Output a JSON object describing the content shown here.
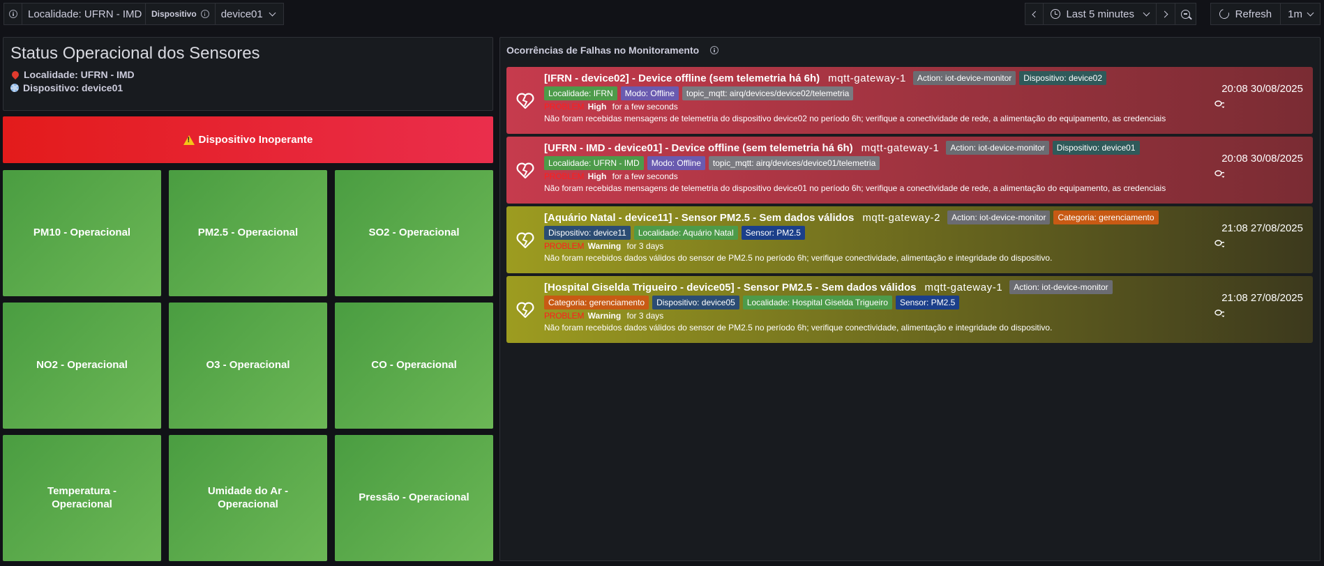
{
  "toolbar": {
    "localidade_label": "Localidade: UFRN - IMD",
    "dispositivo_label": "Dispositivo",
    "dispositivo_value": "device01",
    "time_range": "Last 5 minutes",
    "refresh_label": "Refresh",
    "refresh_interval": "1m"
  },
  "status": {
    "title": "Status Operacional dos Sensores",
    "localidade": "Localidade: UFRN - IMD",
    "dispositivo": "Dispositivo: device01",
    "banner": "Dispositivo Inoperante"
  },
  "sensors": [
    "PM10 - Operacional",
    "PM2.5 - Operacional",
    "SO2 - Operacional",
    "NO2 - Operacional",
    "O3 - Operacional",
    "CO - Operacional",
    "Temperatura - Operacional",
    "Umidade do Ar - Operacional",
    "Pressão - Operacional"
  ],
  "alerts_panel": {
    "title": "Ocorrências de Falhas no Monitoramento",
    "items": [
      {
        "level": "critical",
        "title": "[IFRN - device02] - Device offline (sem telemetria há 6h)",
        "source": "mqtt-gateway-1",
        "tags_row1": [
          "Action: iot-device-monitor",
          "Dispositivo: device02"
        ],
        "tags_row2": [
          "Localidade: IFRN",
          "Modo: Offline",
          "topic_mqtt: airq/devices/device02/telemetria"
        ],
        "state": "PROBLEM",
        "severity": "High",
        "ago": "for a few seconds",
        "description": "Não foram recebidas mensagens de telemetria do dispositivo device02 no período 6h; verifique a conectividade de rede, a alimentação do equipamento, as credenciais",
        "time": "20:08 30/08/2025"
      },
      {
        "level": "critical",
        "title": "[UFRN - IMD - device01] - Device offline (sem telemetria há 6h)",
        "source": "mqtt-gateway-1",
        "tags_row1": [
          "Action: iot-device-monitor",
          "Dispositivo: device01"
        ],
        "tags_row2": [
          "Localidade: UFRN - IMD",
          "Modo: Offline",
          "topic_mqtt: airq/devices/device01/telemetria"
        ],
        "state": "PROBLEM",
        "severity": "High",
        "ago": "for a few seconds",
        "description": "Não foram recebidas mensagens de telemetria do dispositivo device01 no período 6h; verifique a conectividade de rede, a alimentação do equipamento, as credenciais",
        "time": "20:08 30/08/2025"
      },
      {
        "level": "warning",
        "title": "[Aquário Natal - device11] - Sensor PM2.5 - Sem dados válidos",
        "source": "mqtt-gateway-2",
        "tags_row1": [
          "Action: iot-device-monitor",
          "Categoria: gerenciamento"
        ],
        "tags_row2": [
          "Dispositivo: device11",
          "Localidade: Aquário Natal",
          "Sensor: PM2.5"
        ],
        "state": "PROBLEM",
        "severity": "Warning",
        "ago": "for 3 days",
        "description": "Não foram recebidos dados válidos do sensor de PM2.5 no período 6h; verifique conectividade, alimentação e integridade do dispositivo.",
        "time": "21:08 27/08/2025"
      },
      {
        "level": "warning",
        "title": "[Hospital Giselda Trigueiro - device05] - Sensor PM2.5 - Sem dados válidos",
        "source": "mqtt-gateway-1",
        "tags_row1": [
          "Action: iot-device-monitor"
        ],
        "tags_row2": [
          "Categoria: gerenciamento",
          "Dispositivo: device05",
          "Localidade: Hospital Giselda Trigueiro",
          "Sensor: PM2.5"
        ],
        "state": "PROBLEM",
        "severity": "Warning",
        "ago": "for 3 days",
        "description": "Não foram recebidos dados válidos do sensor de PM2.5 no período 6h; verifique conectividade, alimentação e integridade do dispositivo.",
        "time": "21:08 27/08/2025"
      }
    ]
  },
  "colors": {
    "tag_action": "#6b6c72",
    "tag_dispositivo_teal": "#2f5a5a",
    "tag_localidade_green": "#4d9b4a",
    "tag_modo_purple": "#6a5bb0",
    "tag_topic_gray": "#7a7a80",
    "tag_categoria_orange": "#c85a14",
    "tag_dispositivo_blue": "#2b4c73",
    "tag_sensor_blue": "#1b3f8a"
  }
}
